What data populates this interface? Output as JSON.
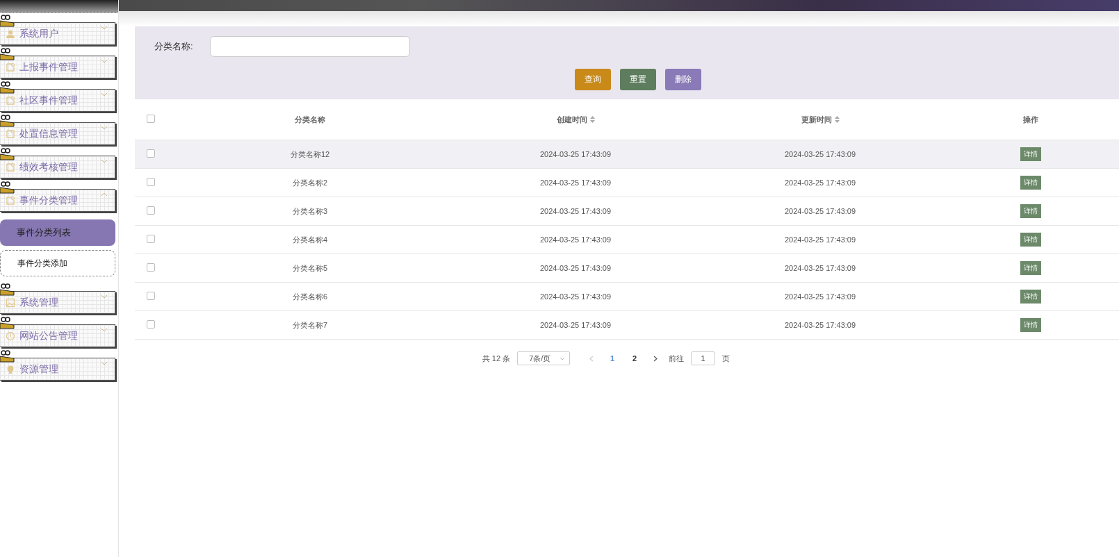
{
  "sidebar": {
    "items": [
      {
        "label": "系统用户",
        "kind": "user",
        "expanded": false
      },
      {
        "label": "上报事件管理",
        "kind": "doc",
        "expanded": false
      },
      {
        "label": "社区事件管理",
        "kind": "doc",
        "expanded": false
      },
      {
        "label": "处置信息管理",
        "kind": "doc",
        "expanded": false
      },
      {
        "label": "绩效考核管理",
        "kind": "doc",
        "expanded": false
      },
      {
        "label": "事件分类管理",
        "kind": "doc",
        "expanded": true,
        "children": [
          {
            "label": "事件分类列表",
            "selected": true
          },
          {
            "label": "事件分类添加",
            "selected": false
          }
        ]
      },
      {
        "label": "系统管理",
        "kind": "image",
        "expanded": false
      },
      {
        "label": "网站公告管理",
        "kind": "info",
        "expanded": false
      },
      {
        "label": "资源管理",
        "kind": "bulb",
        "expanded": false
      }
    ]
  },
  "search": {
    "label": "分类名称:",
    "buttons": [
      {
        "label": "查询",
        "kind": "query"
      },
      {
        "label": "重置",
        "kind": "reset"
      },
      {
        "label": "删除",
        "kind": "delete"
      }
    ]
  },
  "table": {
    "all_checked": false,
    "columns": [
      {
        "label": "分类名称",
        "sortable": false
      },
      {
        "label": "创建时间",
        "sortable": true
      },
      {
        "label": "更新时间",
        "sortable": true
      },
      {
        "label": "操作",
        "sortable": false
      }
    ],
    "rows": [
      {
        "checked": false,
        "name": "分类名称12",
        "created": "2024-03-25 17:43:09",
        "updated": "2024-03-25 17:43:09",
        "action": "详情",
        "hovered": true
      },
      {
        "checked": false,
        "name": "分类名称2",
        "created": "2024-03-25 17:43:09",
        "updated": "2024-03-25 17:43:09",
        "action": "详情",
        "hovered": false
      },
      {
        "checked": false,
        "name": "分类名称3",
        "created": "2024-03-25 17:43:09",
        "updated": "2024-03-25 17:43:09",
        "action": "详情",
        "hovered": false
      },
      {
        "checked": false,
        "name": "分类名称4",
        "created": "2024-03-25 17:43:09",
        "updated": "2024-03-25 17:43:09",
        "action": "详情",
        "hovered": false
      },
      {
        "checked": false,
        "name": "分类名称5",
        "created": "2024-03-25 17:43:09",
        "updated": "2024-03-25 17:43:09",
        "action": "详情",
        "hovered": false
      },
      {
        "checked": false,
        "name": "分类名称6",
        "created": "2024-03-25 17:43:09",
        "updated": "2024-03-25 17:43:09",
        "action": "详情",
        "hovered": false
      },
      {
        "checked": false,
        "name": "分类名称7",
        "created": "2024-03-25 17:43:09",
        "updated": "2024-03-25 17:43:09",
        "action": "详情",
        "hovered": false
      }
    ]
  },
  "pagination": {
    "total": "共 12 条",
    "page_size": "7条/页",
    "pages": [
      {
        "label": "1",
        "selected": true
      },
      {
        "label": "2",
        "selected": false
      }
    ],
    "goto_label": "前往",
    "goto_value": "1",
    "page_suffix": "页"
  }
}
